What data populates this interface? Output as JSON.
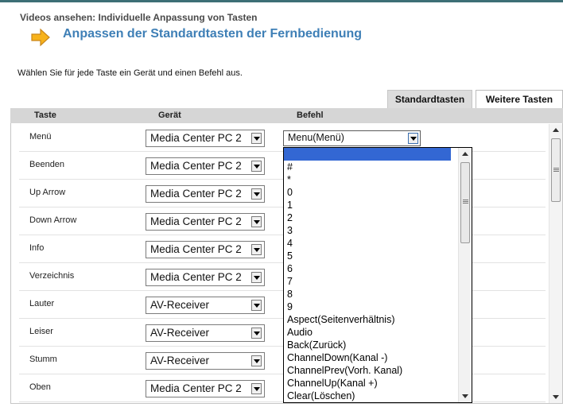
{
  "breadcrumb": "Videos ansehen: Individuelle Anpassung von Tasten",
  "title": "Anpassen der Standardtasten der Fernbedienung",
  "instruction": "Wählen Sie für jede Taste ein Gerät und einen Befehl aus.",
  "tabs": [
    {
      "label": "Standardtasten",
      "active": true
    },
    {
      "label": "Weitere Tasten",
      "active": false
    }
  ],
  "columns": {
    "taste": "Taste",
    "geraet": "Gerät",
    "befehl": "Befehl"
  },
  "rows": [
    {
      "taste": "Menü",
      "geraet": "Media Center PC 2"
    },
    {
      "taste": "Beenden",
      "geraet": "Media Center PC 2"
    },
    {
      "taste": "Up Arrow",
      "geraet": "Media Center PC 2"
    },
    {
      "taste": "Down Arrow",
      "geraet": "Media Center PC 2"
    },
    {
      "taste": "Info",
      "geraet": "Media Center PC 2"
    },
    {
      "taste": "Verzeichnis",
      "geraet": "Media Center PC 2"
    },
    {
      "taste": "Lauter",
      "geraet": "AV-Receiver"
    },
    {
      "taste": "Leiser",
      "geraet": "AV-Receiver"
    },
    {
      "taste": "Stumm",
      "geraet": "AV-Receiver"
    },
    {
      "taste": "Oben",
      "geraet": "Media Center PC 2"
    }
  ],
  "command_select": {
    "value": "Menu(Menü)"
  },
  "command_options": [
    "",
    "#",
    "*",
    "0",
    "1",
    "2",
    "3",
    "4",
    "5",
    "6",
    "7",
    "8",
    "9",
    "Aspect(Seitenverhältnis)",
    "Audio",
    "Back(Zurück)",
    "ChannelDown(Kanal -)",
    "ChannelPrev(Vorh. Kanal)",
    "ChannelUp(Kanal +)",
    "Clear(Löschen)"
  ],
  "colors": {
    "title": "#3e7fb6",
    "selection": "#3367d3",
    "header": "#d6d6d6"
  }
}
